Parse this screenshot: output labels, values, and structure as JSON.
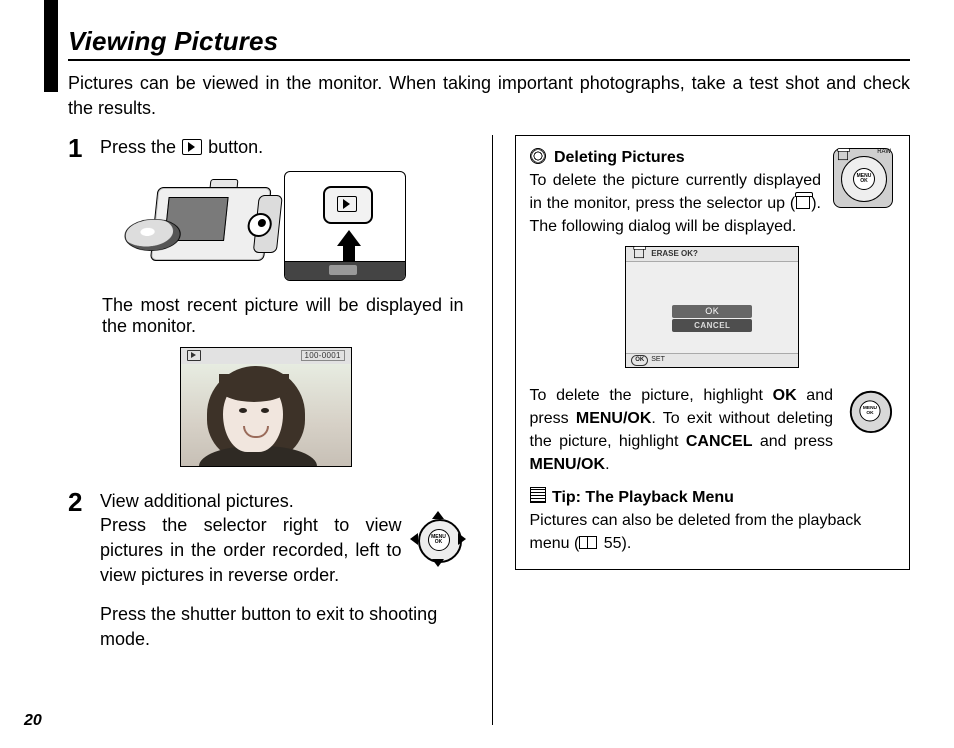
{
  "title": "Viewing Pictures",
  "intro": "Pictures can be viewed in the monitor.  When taking important photographs, take a test shot and check the results.",
  "step1": {
    "num": "1",
    "line_pre": "Press the ",
    "line_post": " button.",
    "after": "The most recent picture will be displayed in the monitor.",
    "lcd_frame": "100-0001"
  },
  "step2": {
    "num": "2",
    "head": "View additional pictures.",
    "body": "Press the selector right to view pictures in the order recorded, left to view pictures in reverse order.",
    "exit": "Press the shutter button to exit to shooting mode.",
    "dpad_label": "MENU\nOK"
  },
  "del": {
    "head": "Deleting Pictures",
    "p_pre": "To delete the picture currently displayed in the monitor, press the selector up (",
    "p_post": "). The following dialog will be displayed.",
    "dpad_top_label": "RAW",
    "dpad_center": "MENU\nOK",
    "dlg_title": "ERASE  OK?",
    "dlg_ok": "OK",
    "dlg_cancel": "CANCEL",
    "dlg_set_pill": "OK",
    "dlg_set": "SET",
    "p2a": "To delete the picture, highlight ",
    "p2_ok": "OK",
    "p2b": " and press ",
    "p2_menuok1": "MENU/OK",
    "p2c": ".  To exit without deleting the picture, highlight ",
    "p2_cancel": "CANCEL",
    "p2d": " and press ",
    "p2_menuok2": "MENU/OK",
    "p2e": "."
  },
  "tip2": {
    "head": "Tip: The Playback Menu",
    "body_pre": "Pictures can also be deleted from the playback menu (",
    "page_ref": " 55).",
    "bottom_dpad_center": "MENU\nOK"
  },
  "page_number": "20"
}
